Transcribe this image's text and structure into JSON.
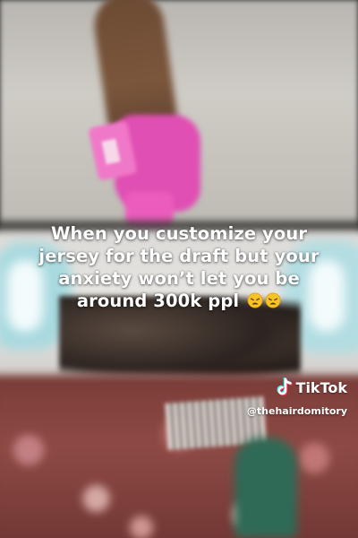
{
  "caption": {
    "line1": "When you customize your",
    "line2": "jersey for the draft but your",
    "line3": "anxiety won’t let you be",
    "line4": "around 300k ppl",
    "emoji_icon": "weary-face-emoji"
  },
  "watermark": {
    "brand": "TikTok",
    "handle": "@thehairdomitory",
    "logo_icon": "tiktok-note-icon"
  }
}
